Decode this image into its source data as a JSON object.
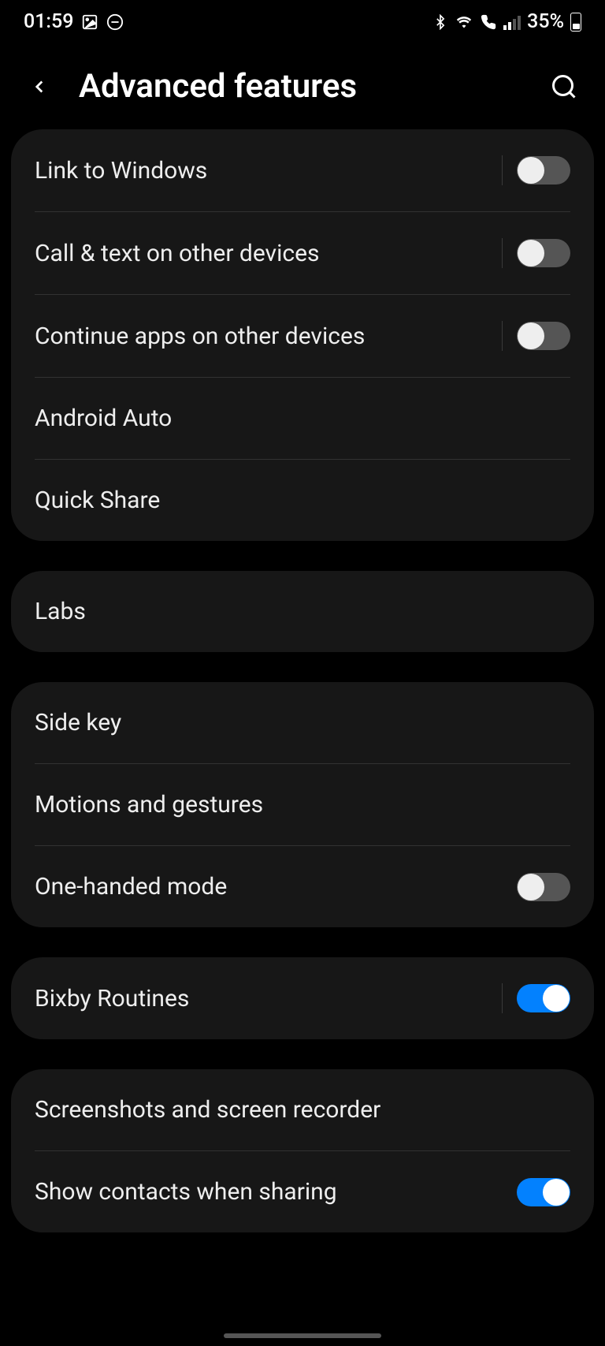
{
  "statusBar": {
    "time": "01:59",
    "batteryPercent": "35%"
  },
  "header": {
    "title": "Advanced features"
  },
  "sections": [
    {
      "items": [
        {
          "label": "Link to Windows",
          "toggle": false,
          "hasDivider": true
        },
        {
          "label": "Call & text on other devices",
          "toggle": false,
          "hasDivider": true
        },
        {
          "label": "Continue apps on other devices",
          "toggle": false,
          "hasDivider": true
        },
        {
          "label": "Android Auto"
        },
        {
          "label": "Quick Share"
        }
      ]
    },
    {
      "items": [
        {
          "label": "Labs"
        }
      ]
    },
    {
      "items": [
        {
          "label": "Side key"
        },
        {
          "label": "Motions and gestures"
        },
        {
          "label": "One-handed mode",
          "toggle": false
        }
      ]
    },
    {
      "items": [
        {
          "label": "Bixby Routines",
          "toggle": true,
          "hasDivider": true
        }
      ]
    },
    {
      "items": [
        {
          "label": "Screenshots and screen recorder"
        },
        {
          "label": "Show contacts when sharing",
          "toggle": true
        }
      ]
    }
  ]
}
